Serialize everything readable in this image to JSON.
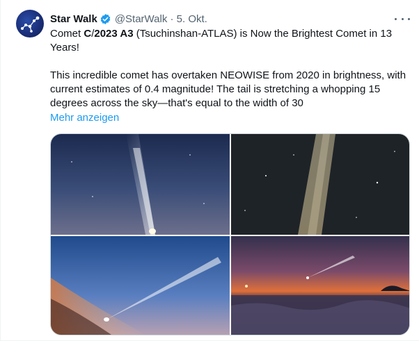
{
  "account": {
    "name": "Star Walk",
    "handle_date": "@StarWalk · 5. Okt."
  },
  "tweet": {
    "line1_a": "Comet ",
    "line1_b": "C",
    "line1_c": "/",
    "line1_d": "2023 A3",
    "line1_e": " (Tsuchinshan-ATLAS) is Now the Brightest Comet in 13 Years!",
    "body": "This incredible comet has overtaken NEOWISE from 2020 in brightness, with current estimates of 0.4 magnitude! The tail is stretching a whopping 15 degrees across the sky—that's equal to the width of 30",
    "show_more": "Mehr anzeigen"
  },
  "icons": {
    "verified": "verified-badge-icon",
    "more": "more-options-icon"
  },
  "colors": {
    "link": "#1d9bf0",
    "secondary_text": "#536471",
    "verified": "#1d9bf0"
  }
}
